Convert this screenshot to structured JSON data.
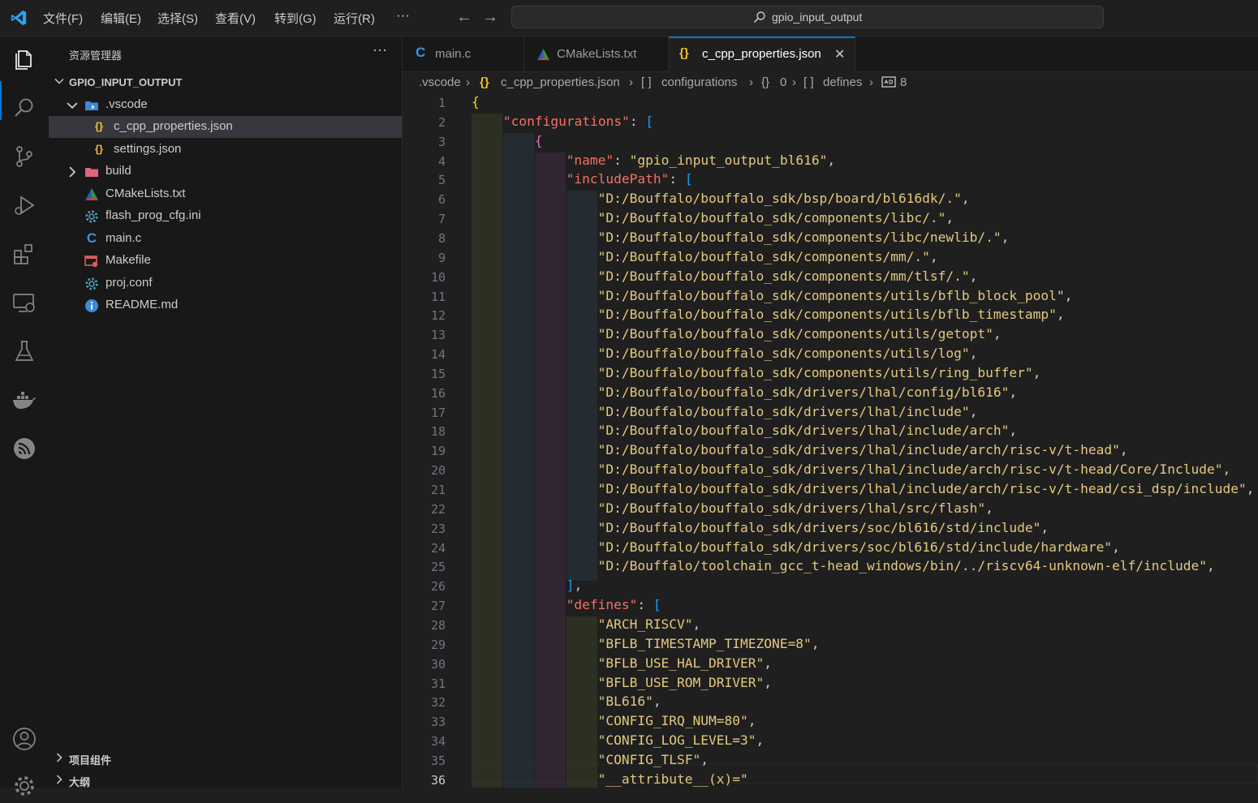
{
  "titlebar": {
    "menu": [
      "文件(F)",
      "编辑(E)",
      "选择(S)",
      "查看(V)",
      "转到(G)",
      "运行(R)",
      "···"
    ],
    "search_text": "gpio_input_output",
    "back": "←",
    "forward": "→"
  },
  "explorer": {
    "title": "资源管理器",
    "more": "···",
    "folder": "GPIO_INPUT_OUTPUT",
    "items": [
      {
        "label": ".vscode",
        "icon": "vscode-folder-icon",
        "chevron": "down"
      },
      {
        "label": "c_cpp_properties.json",
        "icon": "json-braces-icon",
        "selected": true
      },
      {
        "label": "settings.json",
        "icon": "json-braces-icon"
      },
      {
        "label": "build",
        "icon": "folder-icon",
        "chevron": "right"
      },
      {
        "label": "CMakeLists.txt",
        "icon": "cmake-triangle-icon"
      },
      {
        "label": "flash_prog_cfg.ini",
        "icon": "gear-icon"
      },
      {
        "label": "main.c",
        "icon": "c-language-icon"
      },
      {
        "label": "Makefile",
        "icon": "makefile-icon"
      },
      {
        "label": "proj.conf",
        "icon": "gear-icon"
      },
      {
        "label": "README.md",
        "icon": "info-icon"
      }
    ],
    "sections": [
      "项目组件",
      "大纲"
    ]
  },
  "tabs": [
    {
      "label": "main.c",
      "icon": "c-language-icon"
    },
    {
      "label": "CMakeLists.txt",
      "icon": "cmake-triangle-icon"
    },
    {
      "label": "c_cpp_properties.json",
      "icon": "json-braces-icon",
      "active": true,
      "close": "✕"
    }
  ],
  "breadcrumb": [
    ".vscode",
    "c_cpp_properties.json",
    "configurations",
    "0",
    "defines",
    "8"
  ],
  "editor": {
    "current_line": 36,
    "lines": [
      "{",
      "\"configurations\": [",
      "{",
      "\"name\": \"gpio_input_output_bl616\",",
      "\"includePath\": [",
      "\"D:/Bouffalo/bouffalo_sdk/bsp/board/bl616dk/.\",",
      "\"D:/Bouffalo/bouffalo_sdk/components/libc/.\",",
      "\"D:/Bouffalo/bouffalo_sdk/components/libc/newlib/.\",",
      "\"D:/Bouffalo/bouffalo_sdk/components/mm/.\",",
      "\"D:/Bouffalo/bouffalo_sdk/components/mm/tlsf/.\",",
      "\"D:/Bouffalo/bouffalo_sdk/components/utils/bflb_block_pool\",",
      "\"D:/Bouffalo/bouffalo_sdk/components/utils/bflb_timestamp\",",
      "\"D:/Bouffalo/bouffalo_sdk/components/utils/getopt\",",
      "\"D:/Bouffalo/bouffalo_sdk/components/utils/log\",",
      "\"D:/Bouffalo/bouffalo_sdk/components/utils/ring_buffer\",",
      "\"D:/Bouffalo/bouffalo_sdk/drivers/lhal/config/bl616\",",
      "\"D:/Bouffalo/bouffalo_sdk/drivers/lhal/include\",",
      "\"D:/Bouffalo/bouffalo_sdk/drivers/lhal/include/arch\",",
      "\"D:/Bouffalo/bouffalo_sdk/drivers/lhal/include/arch/risc-v/t-head\",",
      "\"D:/Bouffalo/bouffalo_sdk/drivers/lhal/include/arch/risc-v/t-head/Core/Include\",",
      "\"D:/Bouffalo/bouffalo_sdk/drivers/lhal/include/arch/risc-v/t-head/csi_dsp/include\",",
      "\"D:/Bouffalo/bouffalo_sdk/drivers/lhal/src/flash\",",
      "\"D:/Bouffalo/bouffalo_sdk/drivers/soc/bl616/std/include\",",
      "\"D:/Bouffalo/bouffalo_sdk/drivers/soc/bl616/std/include/hardware\",",
      "\"D:/Bouffalo/toolchain_gcc_t-head_windows/bin/../riscv64-unknown-elf/include\",",
      "],",
      "\"defines\": [",
      "\"ARCH_RISCV\",",
      "\"BFLB_TIMESTAMP_TIMEZONE=8\",",
      "\"BFLB_USE_HAL_DRIVER\",",
      "\"BFLB_USE_ROM_DRIVER\",",
      "\"BL616\",",
      "\"CONFIG_IRQ_NUM=80\",",
      "\"CONFIG_LOG_LEVEL=3\",",
      "\"CONFIG_TLSF\",",
      "\"__attribute__(x)=\""
    ]
  },
  "colors": {
    "accent": "#0078d4",
    "key": "#f47067",
    "string": "#e3c97e",
    "bracket1": "#ffd700",
    "bracket2": "#da70d6",
    "bracket3": "#179fff"
  }
}
